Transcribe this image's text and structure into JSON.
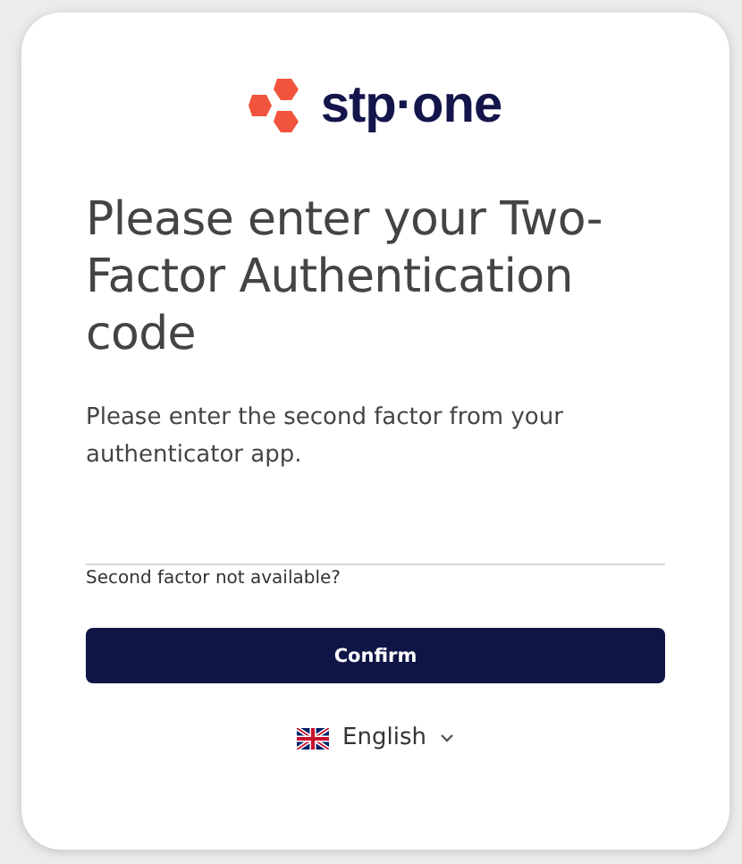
{
  "logo": {
    "text": "stp·one"
  },
  "title": "Please enter your Two-Factor Authentication code",
  "description": "Please enter the second factor from your authenticator app.",
  "help_link": "Second factor not available?",
  "confirm_button": "Confirm",
  "language": {
    "label": "English",
    "expanded": false
  }
}
